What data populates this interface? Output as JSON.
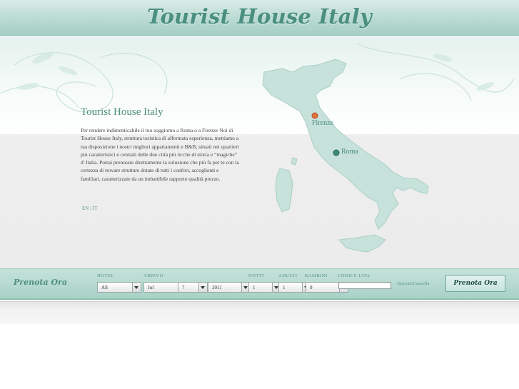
{
  "header": {
    "title": "Tourist House Italy"
  },
  "intro": {
    "title": "Tourist House Italy",
    "body": "Per rendere indimenticabile il tuo soggiorno a Roma o a Firenze Noi di Tourist House Italy, struttura turistica di affermata esperienza, mettiamo a tua disposizione i nostri migliori appartamenti e B&B, situati nei quartieri più caratteristici e centrali delle due città più ricche di storia e “magiche” d' Italia. Potrai prenotare direttamente la soluzione che più fa per te con la certezza di trovare strutture dotate di tutti i confort, accoglienti e familiari, caratterizzate da un imbattibile rapporto qualità prezzo.",
    "languages": [
      "EN",
      "IT"
    ],
    "language_separator": "|"
  },
  "map": {
    "cities": [
      {
        "name": "Firenze",
        "marker_color": "#e0703c"
      },
      {
        "name": "Roma",
        "marker_color": "#3d8a7a"
      }
    ]
  },
  "booking": {
    "title": "Prenota Ora",
    "labels": {
      "hotel": "HOTEL",
      "arrival": "ARRIVO",
      "nights": "NOTTI",
      "adults": "ADULTI",
      "children": "BAMBINI",
      "iata": "CODICE IATA"
    },
    "values": {
      "hotel": "All",
      "month": "Jul",
      "day": "7",
      "year": "2011",
      "nights": "1",
      "adults": "1",
      "children": "0",
      "iata": ""
    },
    "options_link": "Opzioni/Cancella",
    "submit": "Prenota Ora"
  },
  "colors": {
    "accent": "#4a8f80",
    "bar": "#a9d2c7"
  }
}
